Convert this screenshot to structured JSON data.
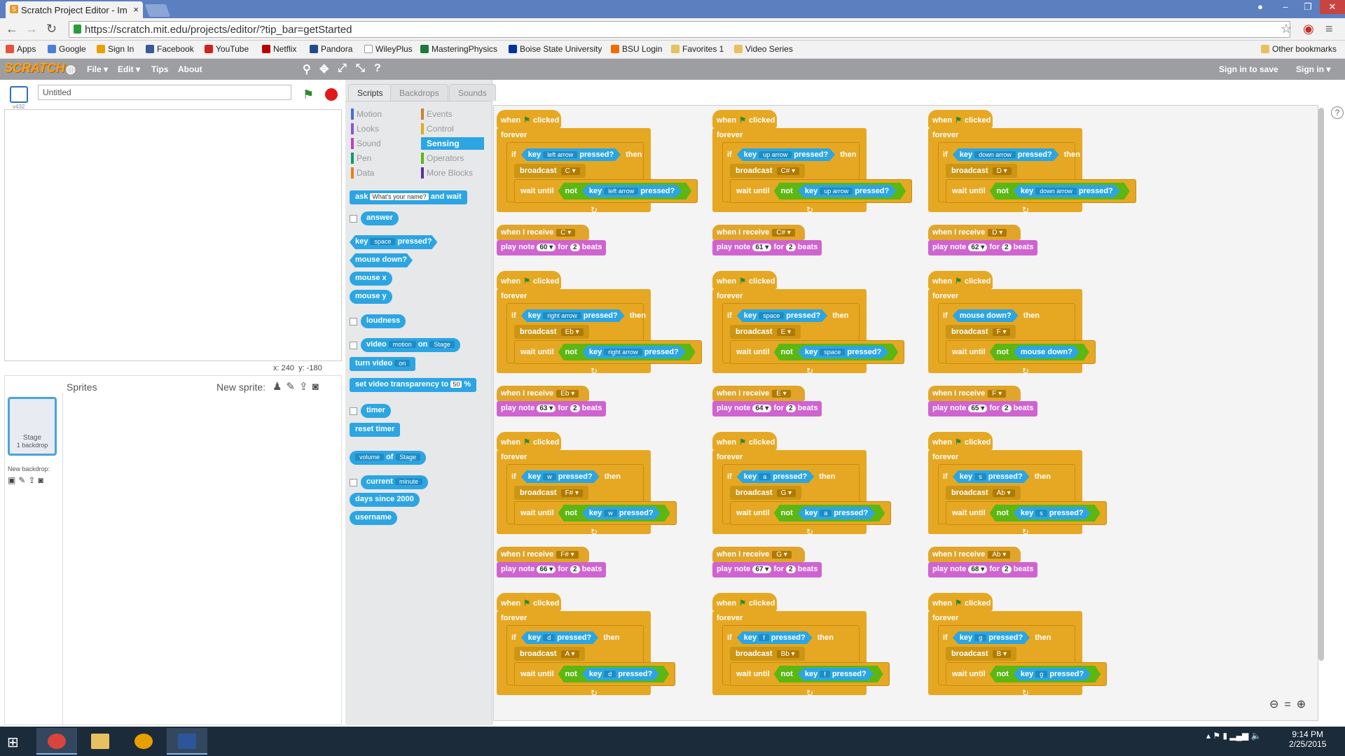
{
  "browser": {
    "tab_title": "Scratch Project Editor - Im",
    "url": "https://scratch.mit.edu/projects/editor/?tip_bar=getStarted",
    "bookmarks": [
      "Apps",
      "Google",
      "Sign In",
      "Facebook",
      "YouTube",
      "Netflix",
      "Pandora",
      "WileyPlus",
      "MasteringPhysics",
      "Boise State University",
      "BSU Login",
      "Favorites 1",
      "Video Series"
    ],
    "other_bookmarks": "Other bookmarks"
  },
  "menu": {
    "logo": "SCRATCH",
    "items": [
      "File ▾",
      "Edit ▾",
      "Tips",
      "About"
    ],
    "sign_in_save": "Sign in to save",
    "sign_in": "Sign in ▾"
  },
  "stage": {
    "version": "v432",
    "title_value": "Untitled",
    "coords_x": "x: 240",
    "coords_y": "y: -180"
  },
  "sprites": {
    "title": "Sprites",
    "new_sprite": "New sprite:",
    "stage_label": "Stage",
    "backdrop_count": "1 backdrop",
    "new_backdrop": "New backdrop:"
  },
  "tabs": [
    "Scripts",
    "Backdrops",
    "Sounds"
  ],
  "categories": [
    {
      "name": "Motion",
      "color": "#4a6cd4"
    },
    {
      "name": "Looks",
      "color": "#8a55d7"
    },
    {
      "name": "Sound",
      "color": "#bb42c3"
    },
    {
      "name": "Pen",
      "color": "#0e9a6c"
    },
    {
      "name": "Data",
      "color": "#ee7d16"
    },
    {
      "name": "Events",
      "color": "#c88330"
    },
    {
      "name": "Control",
      "color": "#e1a91a"
    },
    {
      "name": "Sensing",
      "color": "#2ca5e2"
    },
    {
      "name": "Operators",
      "color": "#5cb712"
    },
    {
      "name": "More Blocks",
      "color": "#632d99"
    }
  ],
  "palette": {
    "ask_a": "ask",
    "ask_input": "What's your name?",
    "ask_b": "and wait",
    "answer": "answer",
    "key_a": "key",
    "key_dd": "space",
    "key_b": "pressed?",
    "mouse_down": "mouse down?",
    "mouse_x": "mouse x",
    "mouse_y": "mouse y",
    "loudness": "loudness",
    "video_a": "video",
    "video_dd": "motion",
    "video_b": "on",
    "video_dd2": "Stage",
    "turn_video": "turn video",
    "turn_video_dd": "on",
    "set_video": "set video transparency to",
    "set_video_val": "50",
    "set_video_pct": "%",
    "timer": "timer",
    "reset_timer": "reset timer",
    "volume_dd": "volume",
    "volume_of": "of",
    "volume_dd2": "Stage",
    "current": "current",
    "current_dd": "minute",
    "days_since": "days since 2000",
    "username": "username"
  },
  "scripts_common": {
    "when": "when",
    "clicked": "clicked",
    "forever": "forever",
    "if": "if",
    "key": "key",
    "pressed": "pressed?",
    "then": "then",
    "broadcast": "broadcast",
    "wait_until": "wait until",
    "not": "not",
    "when_receive": "when I receive",
    "play_note": "play note",
    "for": "for",
    "beats": "beats"
  },
  "scripts": [
    {
      "key": "left arrow",
      "note": "C",
      "num": "60",
      "beats": "2"
    },
    {
      "key": "up arrow",
      "note": "C#",
      "num": "61",
      "beats": "2"
    },
    {
      "key": "down arrow",
      "note": "D",
      "num": "62",
      "beats": "2"
    },
    {
      "key": "right arrow",
      "note": "Eb",
      "num": "63",
      "beats": "2"
    },
    {
      "key": "space",
      "note": "E",
      "num": "64",
      "beats": "2"
    },
    {
      "key": "mouse down?",
      "note": "F",
      "num": "65",
      "beats": "2"
    },
    {
      "key": "w",
      "note": "F#",
      "num": "66",
      "beats": "2"
    },
    {
      "key": "a",
      "note": "G",
      "num": "67",
      "beats": "2"
    },
    {
      "key": "s",
      "note": "Ab",
      "num": "68",
      "beats": "2"
    },
    {
      "key": "d",
      "note": "A"
    },
    {
      "key": "f",
      "note": "Bb"
    },
    {
      "key": "g",
      "note": "B"
    }
  ],
  "taskbar": {
    "time": "9:14 PM",
    "date": "2/25/2015"
  }
}
